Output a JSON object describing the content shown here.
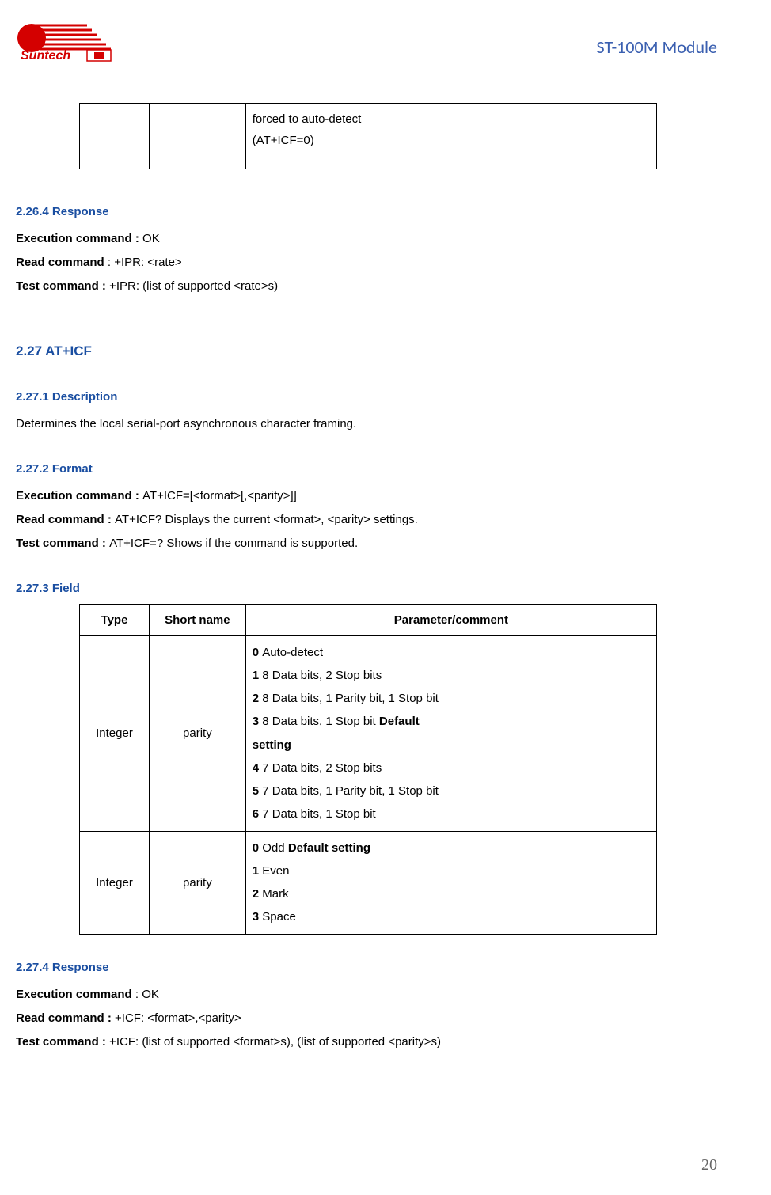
{
  "header": {
    "logo_text": "Suntech",
    "title": "ST-100M Module"
  },
  "top_table_cell": {
    "line1": "forced to auto-detect",
    "line2": "(AT+ICF=0)"
  },
  "s2264": {
    "heading": "2.26.4 Response",
    "exec_label": "Execution command : ",
    "exec_value": "OK",
    "read_label": "Read command ",
    "read_value": ": +IPR: <rate>",
    "test_label": "Test command : ",
    "test_value": "+IPR: (list of supported <rate>s)"
  },
  "s227": {
    "heading": "2.27 AT+ICF"
  },
  "s2271": {
    "heading": "2.27.1 Description",
    "text": "Determines the local serial-port asynchronous character framing."
  },
  "s2272": {
    "heading": "2.27.2 Format",
    "exec_label": "Execution command : ",
    "exec_value": "AT+ICF=[<format>[,<parity>]]",
    "read_label": "Read command : ",
    "read_value": "AT+ICF? Displays the current <format>, <parity> settings.",
    "test_label": "Test command : ",
    "test_value": "AT+ICF=? Shows if the command is supported."
  },
  "s2273": {
    "heading": "2.27.3 Field",
    "th_type": "Type",
    "th_short": "Short name",
    "th_param": "Parameter/comment",
    "row1": {
      "type": "Integer",
      "short": "parity",
      "p0b": "0 ",
      "p0t": "Auto-detect",
      "p1b": "1 ",
      "p1t": "8 Data bits, 2 Stop bits",
      "p2b": "2 ",
      "p2t": "8 Data bits, 1 Parity bit, 1 Stop bit",
      "p3b": "3 ",
      "p3t": "8 Data bits, 1 Stop bit ",
      "p3d": "Default",
      "p3s": "setting",
      "p4b": "4 ",
      "p4t": "7 Data bits, 2 Stop bits",
      "p5b": "5 ",
      "p5t": "7 Data bits, 1 Parity bit, 1 Stop bit",
      "p6b": "6 ",
      "p6t": "7 Data bits, 1 Stop bit"
    },
    "row2": {
      "type": "Integer",
      "short": "parity",
      "p0b": "0 ",
      "p0t": "Odd ",
      "p0d": "Default setting",
      "p1b": "1 ",
      "p1t": "Even",
      "p2b": "2 ",
      "p2t": "Mark",
      "p3b": "3 ",
      "p3t": "Space"
    }
  },
  "s2274": {
    "heading": "2.27.4 Response",
    "exec_label": "Execution command ",
    "exec_value": ": OK",
    "read_label": "Read command : ",
    "read_value": "+ICF: <format>,<parity>",
    "test_label": "Test command : ",
    "test_value": "+ICF: (list of supported <format>s), (list of supported <parity>s)"
  },
  "page_number": "20"
}
